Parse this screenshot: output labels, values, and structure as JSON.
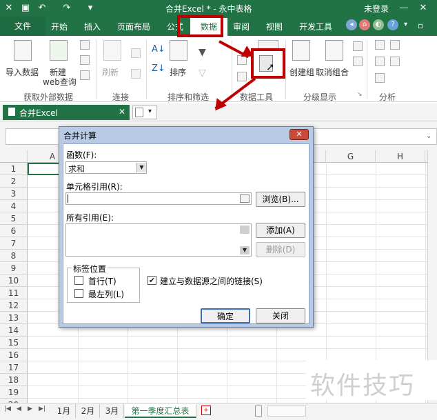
{
  "window": {
    "title": "合并Excel * - 永中表格",
    "login": "未登录",
    "qat_icons": [
      "close-icon",
      "save-icon",
      "undo-icon",
      "redo-icon",
      "customize-icon"
    ],
    "controls": [
      "minimize-icon",
      "close-window-icon"
    ],
    "colors": {
      "brand_green": "#217346",
      "annotation_red": "#c00000"
    }
  },
  "tabs": {
    "file": "文件",
    "home": "开始",
    "insert": "插入",
    "page_layout": "页面布局",
    "formula": "公式",
    "data": "数据",
    "review": "审阅",
    "view": "视图",
    "developer": "开发工具",
    "active": "数据"
  },
  "ribbon": {
    "import_data": "导入数据",
    "new_web_query_1": "新建",
    "new_web_query_2": "web查询",
    "refresh": "刷新",
    "sort": "排序",
    "create_group": "创建组",
    "ungroup": "取消组合",
    "groups": {
      "external": "获取外部数据",
      "connections": "连接",
      "sort_filter": "排序和筛选",
      "data_tools": "数据工具",
      "outline": "分级显示",
      "analysis": "分析"
    }
  },
  "workbook": {
    "tab_name": "合并Excel",
    "close": "✕"
  },
  "grid": {
    "columns": [
      "A",
      "G",
      "H"
    ],
    "rows": [
      "1",
      "2",
      "3",
      "4",
      "5",
      "6",
      "7",
      "8",
      "9",
      "10",
      "11",
      "12",
      "13",
      "14",
      "15",
      "16",
      "17",
      "18",
      "19",
      "20"
    ]
  },
  "sheets": [
    "1月",
    "2月",
    "3月",
    "第一季度汇总表"
  ],
  "active_sheet": "第一季度汇总表",
  "dialog": {
    "title": "合并计算",
    "function_label": "函数(F):",
    "function_value": "求和",
    "ref_label": "单元格引用(R):",
    "ref_value": "",
    "browse": "浏览(B)...",
    "all_refs_label": "所有引用(E):",
    "add": "添加(A)",
    "delete": "删除(D)",
    "label_position": "标签位置",
    "top_row": "首行(T)",
    "left_column": "最左列(L)",
    "top_row_checked": false,
    "left_column_checked": false,
    "link_source": "建立与数据源之间的链接(S)",
    "link_source_checked": true,
    "ok": "确定",
    "close": "关闭"
  },
  "watermark": "软件技巧"
}
